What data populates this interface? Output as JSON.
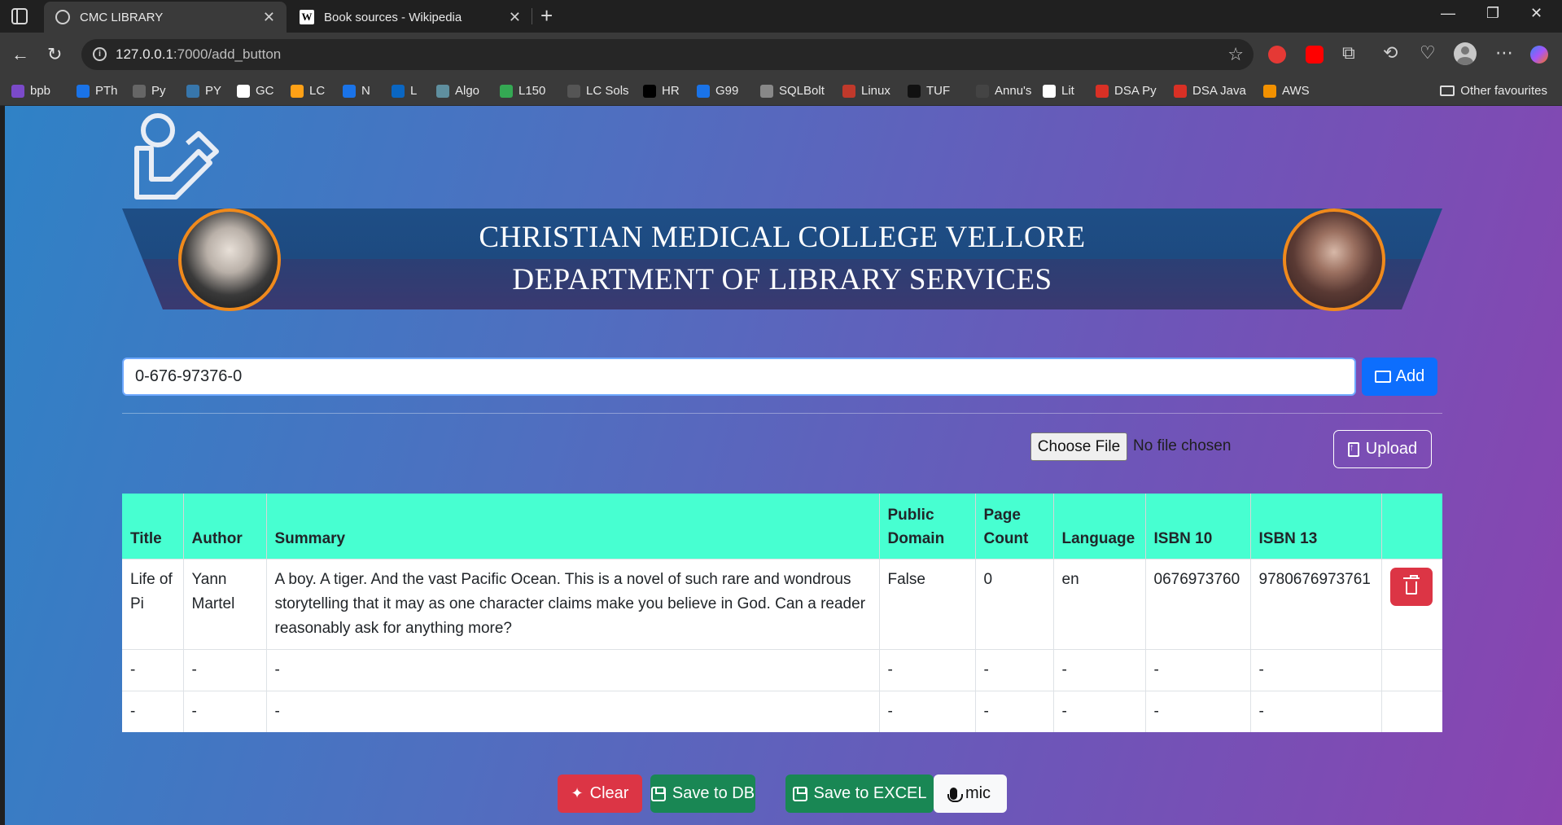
{
  "browser": {
    "tabs": [
      {
        "title": "CMC LIBRARY",
        "active": true
      },
      {
        "title": "Book sources - Wikipedia",
        "active": false
      }
    ],
    "url_host": "127.0.0.1",
    "url_path": ":7000/add_button",
    "bookmarks": [
      {
        "label": "bpb",
        "icon": "bpb-icon",
        "color": "#7b4ac9"
      },
      {
        "label": "PTh",
        "icon": "bookmark-pth-icon",
        "color": "#1a73e8"
      },
      {
        "label": "Py",
        "icon": "gear-icon",
        "color": "#666666"
      },
      {
        "label": "PY",
        "icon": "python-icon",
        "color": "#3776ab"
      },
      {
        "label": "GC",
        "icon": "google-icon",
        "color": "#ffffff"
      },
      {
        "label": "LC",
        "icon": "leetcode-icon",
        "color": "#ffa116"
      },
      {
        "label": "N",
        "icon": "n-icon",
        "color": "#1a73e8"
      },
      {
        "label": "L",
        "icon": "linkedin-icon",
        "color": "#0a66c2"
      },
      {
        "label": "Algo",
        "icon": "algo-icon",
        "color": "#5f8f9f"
      },
      {
        "label": "L150",
        "icon": "plus-icon",
        "color": "#34a853"
      },
      {
        "label": "LC Sols",
        "icon": "w-icon",
        "color": "#555555"
      },
      {
        "label": "HR",
        "icon": "hackerrank-icon",
        "color": "#000000"
      },
      {
        "label": "G99",
        "icon": "g99-icon",
        "color": "#1a73e8"
      },
      {
        "label": "SQLBolt",
        "icon": "database-icon",
        "color": "#888888"
      },
      {
        "label": "Linux",
        "icon": "linux-icon",
        "color": "#c0392b"
      },
      {
        "label": "TUF",
        "icon": "tuf-icon",
        "color": "#111111"
      },
      {
        "label": "Annu's",
        "icon": "annu-icon",
        "color": "#444444"
      },
      {
        "label": "Lit",
        "icon": "lit-icon",
        "color": "#ffffff"
      },
      {
        "label": "DSA Py",
        "icon": "pdf-icon",
        "color": "#d93025"
      },
      {
        "label": "DSA Java",
        "icon": "pdf-icon",
        "color": "#d93025"
      },
      {
        "label": "AWS",
        "icon": "aws-icon",
        "color": "#f29100"
      }
    ],
    "other_favourites": "Other favourites"
  },
  "header": {
    "title_line1": "CHRISTIAN MEDICAL COLLEGE VELLORE",
    "title_line2": "DEPARTMENT OF LIBRARY SERVICES"
  },
  "isbn_form": {
    "input_value": "0-676-97376-0",
    "add_label": "Add"
  },
  "upload_form": {
    "choose_file_label": "Choose File",
    "no_file_text": "No file chosen",
    "upload_label": "Upload"
  },
  "table": {
    "columns": [
      "Title",
      "Author",
      "Summary",
      "Public Domain",
      "Page Count",
      "Language",
      "ISBN 10",
      "ISBN 13",
      ""
    ],
    "rows": [
      [
        "Life of Pi",
        "Yann Martel",
        "A boy. A tiger. And the vast Pacific Ocean. This is a novel of such rare and wondrous storytelling that it may as one character claims make you believe in God. Can a reader reasonably ask for anything more?",
        "False",
        "0",
        "en",
        "0676973760",
        "9780676973761"
      ],
      [
        "-",
        "-",
        "-",
        "-",
        "-",
        "-",
        "-",
        "-"
      ],
      [
        "-",
        "-",
        "-",
        "-",
        "-",
        "-",
        "-",
        "-"
      ]
    ]
  },
  "actions": {
    "clear_label": "Clear",
    "save_db_label": "Save to DB",
    "save_excel_label": "Save to EXCEL",
    "mic_label": "mic"
  },
  "colors": {
    "table_header": "#47ffd1",
    "primary": "#0d6efd",
    "danger": "#dc3545",
    "success": "#198754",
    "portrait_border": "#f08a1c"
  }
}
